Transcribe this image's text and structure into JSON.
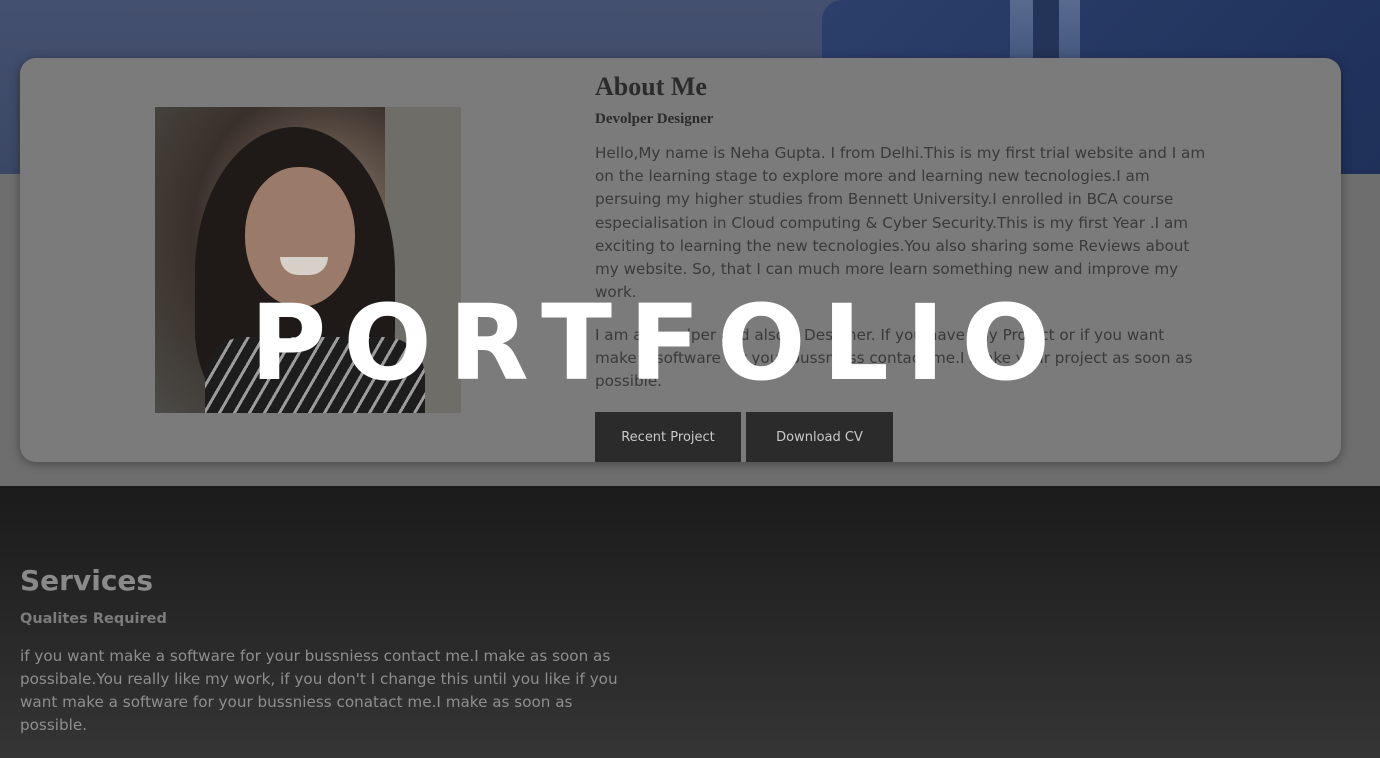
{
  "overlay": {
    "title": "PORTFOLIO"
  },
  "about": {
    "title": "About Me",
    "subtitle": "Devolper Designer",
    "paragraph1": "Hello,My name is Neha Gupta. I from Delhi.This is my first trial website and I am on the learning stage to explore more and learning new tecnologies.I am persuing my higher studies from Bennett University.I enrolled in BCA course especialisation in Cloud computing & Cyber Security.This is my first Year .I am exciting to learning the new tecnologies.You also sharing some Reviews about my website. So, that I can much more learn something new and improve my work.",
    "paragraph2": "I am a Devolper and also a Designer. If you have any Project or if you want make a software for your bussniess contact me.I make your project as soon as possible.",
    "buttons": {
      "recent_project": "Recent Project",
      "download_cv": "Download CV"
    }
  },
  "services": {
    "title": "Services",
    "subtitle": "Qualites Required",
    "paragraph": "if you want make a software for your bussniess contact me.I make as soon as possibale.You really like my work, if you don't I change this until you like if you want make a software for your bussniess conatact me.I make as soon as possible."
  }
}
